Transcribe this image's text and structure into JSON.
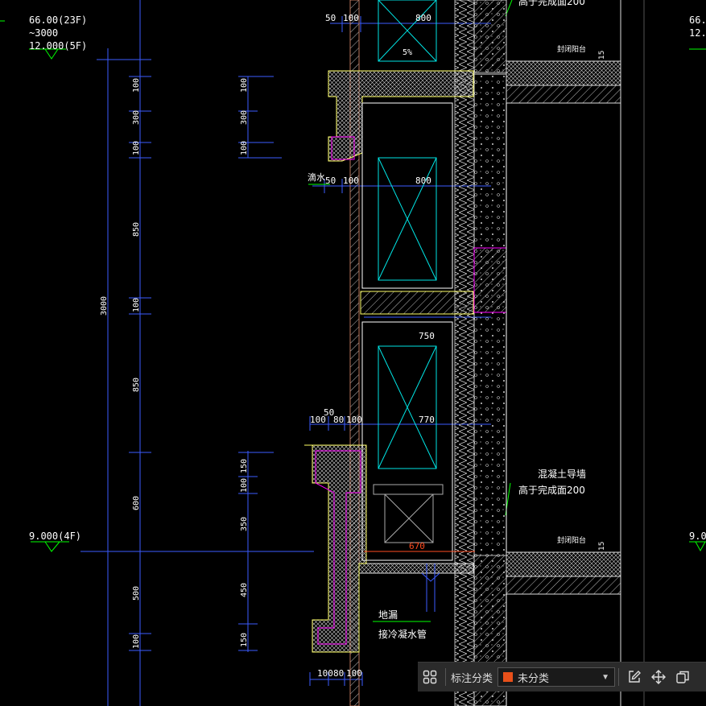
{
  "drawing": {
    "levels": {
      "top_left_1": "66.00(23F)",
      "top_left_2": "~3000",
      "top_left_3": "12.000(5F)",
      "mid_left": "9.000(4F)",
      "right_cut_1": "66.",
      "right_cut_2": "12.",
      "right_cut_3": "9.0"
    },
    "dims_left": {
      "d100a": "100",
      "d300a": "300",
      "d100b": "100",
      "d850a": "850",
      "d100c": "100",
      "d850b": "850",
      "d600": "600",
      "d500": "500",
      "d100d": "100",
      "total": "3000"
    },
    "dims_second": {
      "e100a": "100",
      "e300": "300",
      "e100b": "100",
      "e150a": "150",
      "e100c": "100",
      "e350": "350",
      "e450": "450",
      "e150b": "150"
    },
    "dims_top": {
      "t50a": "50",
      "t100a": "100",
      "t800a": "800",
      "t50b": "50",
      "t100b": "100",
      "t800b": "800",
      "t750": "750",
      "t50c": "50",
      "t100c": "100",
      "t80a": "80",
      "t100d": "100",
      "t770": "770",
      "t670": "670",
      "t100e": "100",
      "t80b": "80",
      "t100f": "100",
      "slope": "5%"
    },
    "notes": {
      "drip": "滴水",
      "concrete_wall": "混凝土导墙",
      "finish_top": "高于完成面200",
      "finish_top_cut": "高于完成面200",
      "floor_drain": "地漏",
      "condensate": "接冷凝水管",
      "balcony_a": "封闭阳台",
      "balcony_b": "封闭阳台",
      "fifteen_a": "15",
      "fifteen_b": "15"
    },
    "colors": {
      "background": "#000000",
      "dimension": "#3b5bff",
      "text": "#ffffff",
      "level": "#00ff00",
      "wall": "#d0d0d0",
      "window": "#00e5e5",
      "insulation": "#ff00ff",
      "accent_dim": "#ff4b1f"
    }
  },
  "toolbar": {
    "grid_icon": "grid-icon",
    "label": "标注分类",
    "select_value": "未分类",
    "swatch_color": "#e8501a",
    "edit_icon": "edit-icon",
    "move_icon": "move-icon",
    "copy_icon": "copy-icon"
  }
}
